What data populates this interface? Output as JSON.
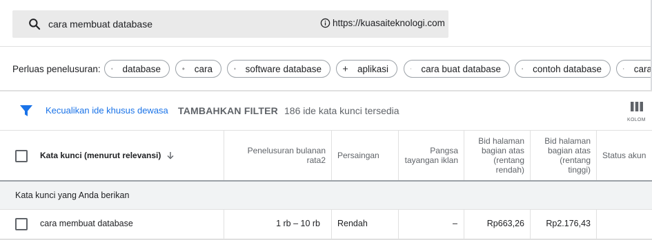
{
  "search": {
    "query": "cara membuat database",
    "url": "https://kuasaiteknologi.com"
  },
  "expand": {
    "label": "Perluas penelusuran:",
    "chips": [
      "database",
      "cara",
      "software database",
      "aplikasi",
      "cara buat database",
      "contoh database",
      "cara"
    ]
  },
  "filter_bar": {
    "exclude_link": "Kecualikan ide khusus dewasa",
    "add_filter": "TAMBAHKAN FILTER",
    "idea_count": "186 ide kata kunci tersedia",
    "columns_label": "KOLOM"
  },
  "table": {
    "headers": {
      "keyword": "Kata kunci (menurut relevansi)",
      "monthly_searches": [
        "Penelusuran bulanan",
        "rata2"
      ],
      "competition": "Persaingan",
      "impression_share": [
        "Pangsa",
        "tayangan iklan"
      ],
      "bid_low": [
        "Bid halaman",
        "bagian atas",
        "(rentang",
        "rendah)"
      ],
      "bid_high": [
        "Bid halaman",
        "bagian atas",
        "(rentang",
        "tinggi)"
      ],
      "account_status": "Status akun"
    },
    "group_label": "Kata kunci yang Anda berikan",
    "rows": [
      {
        "keyword": "cara membuat database",
        "monthly_searches": "1 rb – 10 rb",
        "competition": "Rendah",
        "impression_share": "–",
        "bid_low": "Rp663,26",
        "bid_high": "Rp2.176,43"
      }
    ]
  },
  "colors": {
    "link": "#1a73e8",
    "filter_icon": "#1a73e8",
    "search_bg": "#eaeaea",
    "group_bg": "#f1f3f4"
  }
}
